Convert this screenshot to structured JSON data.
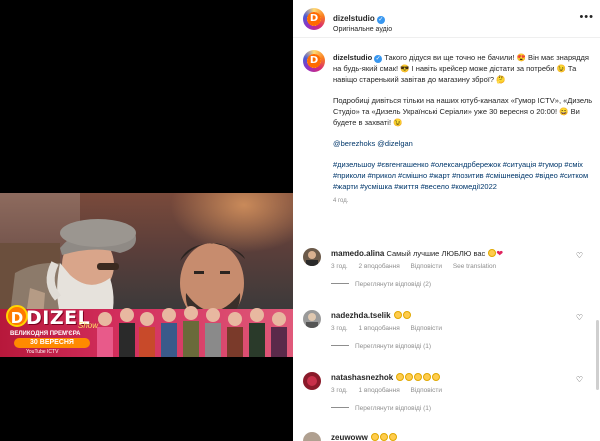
{
  "post": {
    "username": "dizelstudio",
    "subtitle": "Оригінальне аудіо",
    "caption_p1": "Такого дідуся ви ще точно не бачили! 😍 Він має знаряддя на будь-який смак! 😎 І навіть крейсер може дістати за потреби 😉 Та навіщо старенький завітав до магазину зброї? 🤔",
    "caption_p2": "Подробиці дивіться тільки на наших ютуб-каналах «Гумор ICTV», «Дизель Студіо» та «Дизель Українські Серіали» уже 30 вересня о 20:00! 😄 Ви будете в захваті! 😉",
    "mentions": "@berezhoks @dizelgan",
    "hashtags": "#дизельшоу #євгенгашенко #олександрбережок #ситуація #гумор #сміх #приколи #прикол #смішно #жарт #позитив #смішневідео #відео #ситком #жарти #усмішка #життя #весело #комедії2022",
    "time": "4 год."
  },
  "video_overlay": {
    "logo_letter": "D",
    "logo_text": "DIZEL",
    "logo_show": "Show",
    "promo_line1": "ВЕЛИКОДНЯ ПРЕМ'ЄРА",
    "promo_date": "30 ВЕРЕСНЯ",
    "promo_channel": "YouTube ICTV"
  },
  "comments": [
    {
      "username": "mamedo.alina",
      "text": "Самый лучшие ЛЮБЛЮ вас",
      "time": "3 год.",
      "likes": "2 вподобання",
      "reply": "Відповісти",
      "translate": "See translation",
      "view_replies": "Переглянути відповіді (2)"
    },
    {
      "username": "nadezhda.tselik",
      "text": "",
      "time": "3 год.",
      "likes": "1 вподобання",
      "reply": "Відповісти",
      "view_replies": "Переглянути відповіді (1)"
    },
    {
      "username": "natashasnezhok",
      "text": "",
      "time": "3 год.",
      "likes": "1 вподобання",
      "reply": "Відповісти",
      "view_replies": "Переглянути відповіді (1)"
    },
    {
      "username": "zeuwoww",
      "text": ""
    }
  ],
  "icons": [
    "verified-badge-icon",
    "more-options-icon",
    "heart-icon",
    "emoji-icon"
  ],
  "colors": {
    "link": "#00376b",
    "verified": "#3897f0",
    "muted": "#8e8e8e",
    "text": "#262626"
  }
}
